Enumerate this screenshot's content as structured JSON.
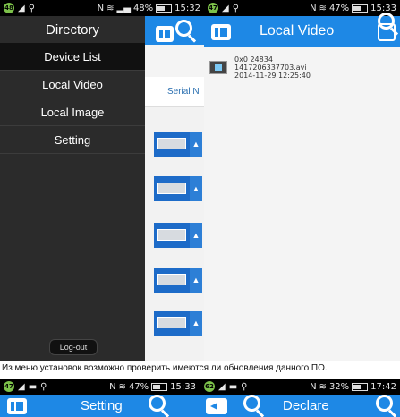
{
  "left": {
    "status": {
      "badge": "48",
      "battery": "48%",
      "time": "15:32"
    },
    "drawer": {
      "title": "Directory",
      "items": [
        {
          "label": "Device List"
        },
        {
          "label": "Local Video"
        },
        {
          "label": "Local Image"
        },
        {
          "label": "Setting"
        }
      ],
      "logout": "Log-out"
    },
    "background": {
      "serial_header": "Serial N"
    }
  },
  "right": {
    "status": {
      "badge": "47",
      "battery": "47%",
      "time": "15:33"
    },
    "title": "Local Video",
    "video": {
      "line1": "0x0    24834",
      "line2": "1417206337703.avi",
      "line3": "2014-11-29  12:25:40"
    }
  },
  "caption": "Из меню установок возможно проверить имеются ли обновления данного ПО.",
  "bottom_left": {
    "status": {
      "badge": "47",
      "battery": "47%",
      "time": "15:33"
    },
    "title": "Setting"
  },
  "bottom_right": {
    "status": {
      "badge": "62",
      "battery": "32%",
      "time": "17:42"
    },
    "title": "Declare"
  },
  "colors": {
    "accent": "#1e88e5",
    "drawer_bg": "#2b2b2b"
  }
}
